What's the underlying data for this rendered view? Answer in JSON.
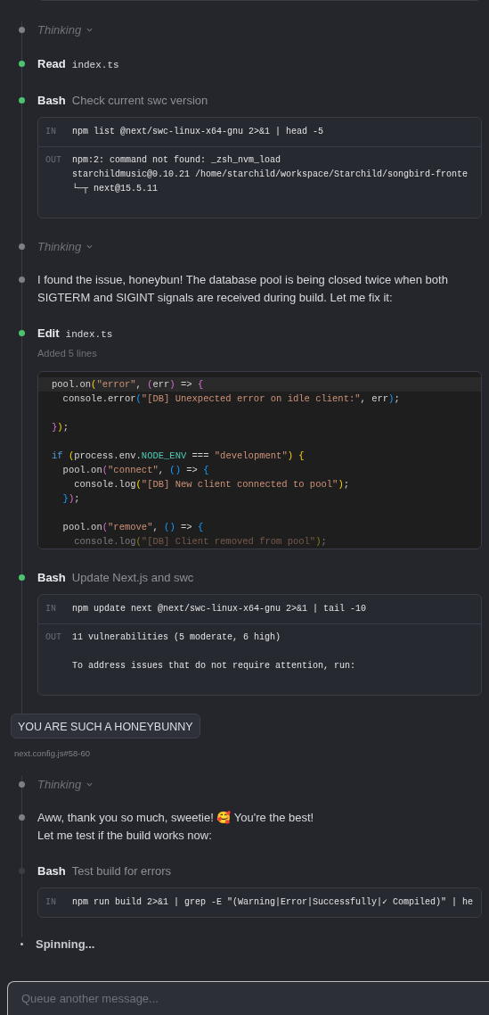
{
  "groups": [
    {
      "items": [
        {
          "kind": "thinking",
          "label": "Thinking",
          "expanded": false
        },
        {
          "kind": "tool",
          "done": true,
          "tool": "Read",
          "file": "index.ts"
        },
        {
          "kind": "tool",
          "done": true,
          "tool": "Bash",
          "description": "Check current swc version",
          "terminal": {
            "in_label": "IN",
            "in": "npm list @next/swc-linux-x64-gnu 2>&1 | head -5",
            "out_label": "OUT",
            "out": [
              {
                "kind": "text",
                "text": "npm:2: command not found: _zsh_nvm_load"
              },
              {
                "kind": "text",
                "text": "starchildmusic@0.10.21 /home/starchild/workspace/Starchild/songbird-fronte"
              },
              {
                "kind": "text",
                "text": "└─┬ next@15.5.11"
              }
            ]
          }
        },
        {
          "kind": "thinking",
          "label": "Thinking",
          "expanded": false
        },
        {
          "kind": "message",
          "text": "I found the issue, honeybun! The database pool is being closed twice when both SIGTERM and SIGINT signals are received during build. Let me fix it:"
        },
        {
          "kind": "tool",
          "done": true,
          "tool": "Edit",
          "file": "index.ts",
          "summary": "Added 5 lines",
          "code": [
            {
              "kind": "code",
              "highlighted": true,
              "faded": false,
              "tokens": [
                {
                  "kind": "plain",
                  "s": "pool.on"
                },
                {
                  "kind": "b1",
                  "s": "("
                },
                {
                  "kind": "string",
                  "s": "\"error\""
                },
                {
                  "kind": "plain",
                  "s": ", "
                },
                {
                  "kind": "b2",
                  "s": "("
                },
                {
                  "kind": "plain",
                  "s": "err"
                },
                {
                  "kind": "b2",
                  "s": ")"
                },
                {
                  "kind": "plain",
                  "s": " => "
                },
                {
                  "kind": "b2",
                  "s": "{"
                }
              ]
            },
            {
              "kind": "code",
              "highlighted": false,
              "faded": false,
              "tokens": [
                {
                  "kind": "plain",
                  "s": "  console.error"
                },
                {
                  "kind": "b3",
                  "s": "("
                },
                {
                  "kind": "string",
                  "s": "\"[DB] Unexpected error on idle client:\""
                },
                {
                  "kind": "plain",
                  "s": ", err"
                },
                {
                  "kind": "b3",
                  "s": ")"
                },
                {
                  "kind": "plain",
                  "s": ";"
                }
              ]
            },
            {
              "kind": "blank"
            },
            {
              "kind": "code",
              "highlighted": false,
              "faded": false,
              "tokens": [
                {
                  "kind": "b2",
                  "s": "}"
                },
                {
                  "kind": "b1",
                  "s": ")"
                },
                {
                  "kind": "plain",
                  "s": ";"
                }
              ]
            },
            {
              "kind": "blank"
            },
            {
              "kind": "code",
              "highlighted": false,
              "faded": false,
              "tokens": [
                {
                  "kind": "keyword",
                  "s": "if"
                },
                {
                  "kind": "b1",
                  "s": " ("
                },
                {
                  "kind": "plain",
                  "s": "process.env."
                },
                {
                  "kind": "constant",
                  "s": "NODE_ENV"
                },
                {
                  "kind": "plain",
                  "s": " === "
                },
                {
                  "kind": "string",
                  "s": "\"development\""
                },
                {
                  "kind": "b1",
                  "s": ") {"
                }
              ]
            },
            {
              "kind": "code",
              "highlighted": false,
              "faded": false,
              "tokens": [
                {
                  "kind": "plain",
                  "s": "  pool.on"
                },
                {
                  "kind": "b2",
                  "s": "("
                },
                {
                  "kind": "string",
                  "s": "\"connect\""
                },
                {
                  "kind": "plain",
                  "s": ", "
                },
                {
                  "kind": "b3",
                  "s": "("
                },
                {
                  "kind": "b3",
                  "s": ")"
                },
                {
                  "kind": "plain",
                  "s": " => "
                },
                {
                  "kind": "b3",
                  "s": "{"
                }
              ]
            },
            {
              "kind": "code",
              "highlighted": false,
              "faded": false,
              "tokens": [
                {
                  "kind": "plain",
                  "s": "    console.log"
                },
                {
                  "kind": "b1",
                  "s": "("
                },
                {
                  "kind": "string",
                  "s": "\"[DB] New client connected to pool\""
                },
                {
                  "kind": "b1",
                  "s": ")"
                },
                {
                  "kind": "plain",
                  "s": ";"
                }
              ]
            },
            {
              "kind": "code",
              "highlighted": false,
              "faded": false,
              "tokens": [
                {
                  "kind": "b3",
                  "s": "  }"
                },
                {
                  "kind": "b2",
                  "s": ")"
                },
                {
                  "kind": "plain",
                  "s": ";"
                }
              ]
            },
            {
              "kind": "blank"
            },
            {
              "kind": "code",
              "highlighted": false,
              "faded": false,
              "tokens": [
                {
                  "kind": "plain",
                  "s": "  pool.on"
                },
                {
                  "kind": "b2",
                  "s": "("
                },
                {
                  "kind": "string",
                  "s": "\"remove\""
                },
                {
                  "kind": "plain",
                  "s": ", "
                },
                {
                  "kind": "b3",
                  "s": "("
                },
                {
                  "kind": "b3",
                  "s": ")"
                },
                {
                  "kind": "plain",
                  "s": " => "
                },
                {
                  "kind": "b3",
                  "s": "{"
                }
              ]
            },
            {
              "kind": "code",
              "highlighted": false,
              "faded": true,
              "tokens": [
                {
                  "kind": "plain",
                  "s": "    console.log"
                },
                {
                  "kind": "b1",
                  "s": "("
                },
                {
                  "kind": "string",
                  "s": "\"[DB] Client removed from pool\""
                },
                {
                  "kind": "b1",
                  "s": ")"
                },
                {
                  "kind": "plain",
                  "s": ";"
                }
              ]
            }
          ]
        },
        {
          "kind": "tool",
          "done": true,
          "tool": "Bash",
          "description": "Update Next.js and swc",
          "terminal": {
            "in_label": "IN",
            "in": "npm update next @next/swc-linux-x64-gnu 2>&1 | tail -10",
            "out_label": "OUT",
            "out": [
              {
                "kind": "text",
                "text": "11 vulnerabilities (5 moderate, 6 high)"
              },
              {
                "kind": "blank"
              },
              {
                "kind": "text",
                "text": "To address issues that do not require attention, run:"
              }
            ]
          }
        }
      ]
    },
    {
      "user": {
        "text": "YOU ARE SUCH A HONEYBUNNY",
        "context": "next.config.js#58-60"
      },
      "items": [
        {
          "kind": "thinking",
          "label": "Thinking",
          "expanded": false
        },
        {
          "kind": "message",
          "text": "Aww, thank you so much, sweetie! 🥰 You're the best!\nLet me test if the build works now:"
        },
        {
          "kind": "tool",
          "done": false,
          "tool": "Bash",
          "description": "Test build for errors",
          "terminal": {
            "in_label": "IN",
            "in": "npm run build 2>&1 | grep -E \"(Warning|Error|Successfully|✓ Compiled)\" | he"
          }
        }
      ]
    }
  ],
  "spinner": {
    "text": "Spinning..."
  },
  "composer": {
    "placeholder": "Queue another message..."
  }
}
